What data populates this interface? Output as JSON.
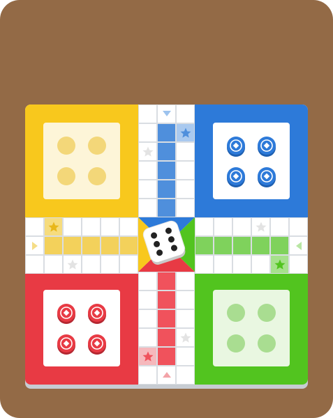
{
  "game": {
    "name": "Ludo",
    "colors": {
      "background": "#936a46",
      "yellow": "#f8c81d",
      "yellow_light": "#f3d15b",
      "blue": "#2d7ad9",
      "blue_light": "#4f8fdc",
      "red": "#e83a44",
      "red_light": "#f0525c",
      "green": "#52c41f",
      "green_light": "#7fd25c",
      "safe_star": "#e3e3e3"
    },
    "bases": [
      {
        "color": "yellow",
        "tokens_at_home": 4,
        "token_style": "ghost"
      },
      {
        "color": "blue",
        "tokens_at_home": 4,
        "token_style": "piece"
      },
      {
        "color": "red",
        "tokens_at_home": 4,
        "token_style": "piece"
      },
      {
        "color": "green",
        "tokens_at_home": 4,
        "token_style": "ghost"
      }
    ],
    "dice": {
      "value": 6,
      "icon": "dice-six-icon"
    }
  }
}
